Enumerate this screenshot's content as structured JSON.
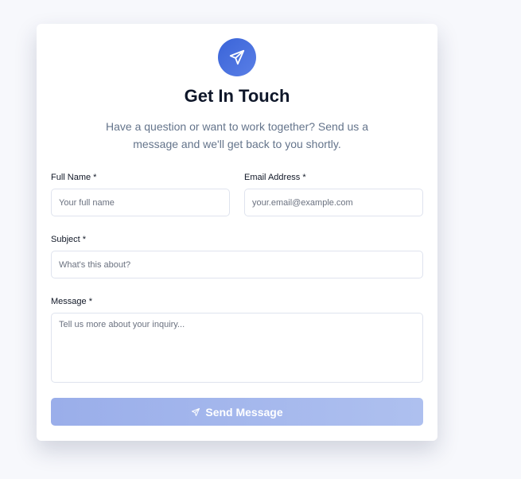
{
  "header": {
    "icon": "send-icon",
    "title": "Get In Touch",
    "subtitle": "Have a question or want to work together? Send us a message and we'll get back to you shortly."
  },
  "form": {
    "full_name": {
      "label": "Full Name *",
      "placeholder": "Your full name"
    },
    "email": {
      "label": "Email Address *",
      "placeholder": "your.email@example.com"
    },
    "subject": {
      "label": "Subject *",
      "placeholder": "What's this about?"
    },
    "message": {
      "label": "Message *",
      "placeholder": "Tell us more about your inquiry..."
    },
    "submit_label": "Send Message"
  },
  "colors": {
    "accent": "#3a64d8",
    "button": "#9aaeea"
  }
}
